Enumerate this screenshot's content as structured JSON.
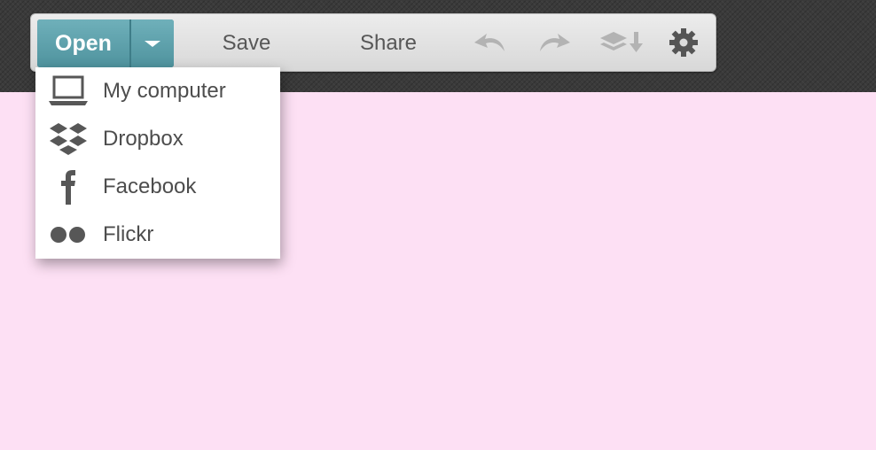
{
  "toolbar": {
    "open_label": "Open",
    "save_label": "Save",
    "share_label": "Share",
    "icons": [
      "chevron-down-icon",
      "undo-icon",
      "redo-icon",
      "layers-download-icon",
      "gear-icon"
    ]
  },
  "open_menu": {
    "items": [
      {
        "label": "My computer",
        "icon": "laptop-icon"
      },
      {
        "label": "Dropbox",
        "icon": "dropbox-icon"
      },
      {
        "label": "Facebook",
        "icon": "facebook-icon"
      },
      {
        "label": "Flickr",
        "icon": "flickr-icon"
      }
    ]
  },
  "colors": {
    "canvas_background": "#fde0f4",
    "topbar_background": "#3a3a3a",
    "open_button": "#5fa1ab",
    "toolbar_text": "#575757",
    "disabled_icon": "#b3b3b3",
    "menu_text": "#4d4d4d"
  }
}
